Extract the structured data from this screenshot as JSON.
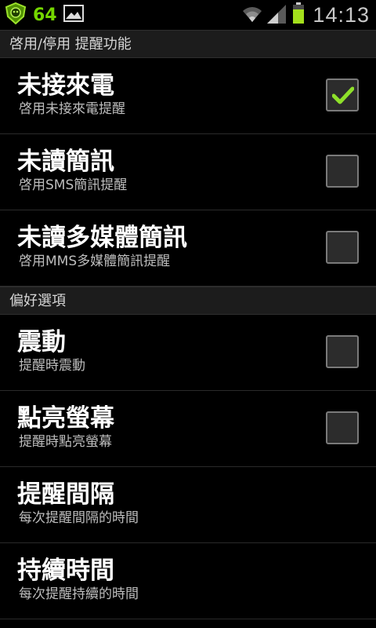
{
  "status_bar": {
    "notification_count": "64",
    "time": "14:13",
    "icons": [
      "app-shield-icon",
      "image-icon",
      "wifi-icon",
      "signal-icon",
      "battery-icon"
    ]
  },
  "sections": [
    {
      "header": "啓用/停用  提醒功能",
      "rows": [
        {
          "title": "未接來電",
          "subtitle": "啓用未接來電提醒",
          "checked": true
        },
        {
          "title": "未讀簡訊",
          "subtitle": "啓用SMS簡訊提醒",
          "checked": false
        },
        {
          "title": "未讀多媒體簡訊",
          "subtitle": "啓用MMS多媒體簡訊提醒",
          "checked": false
        }
      ]
    },
    {
      "header": "偏好選項",
      "rows": [
        {
          "title": "震動",
          "subtitle": "提醒時震動",
          "checked": false
        },
        {
          "title": "點亮螢幕",
          "subtitle": "提醒時點亮螢幕",
          "checked": false
        },
        {
          "title": "提醒間隔",
          "subtitle": "每次提醒間隔的時間"
        },
        {
          "title": "持續時間",
          "subtitle": "每次提醒持續的時間"
        }
      ]
    }
  ],
  "colors": {
    "accent_green": "#74d600",
    "background": "#000000",
    "section_header_bg": "#1c1c1c",
    "check_green": "#8ee02a"
  }
}
